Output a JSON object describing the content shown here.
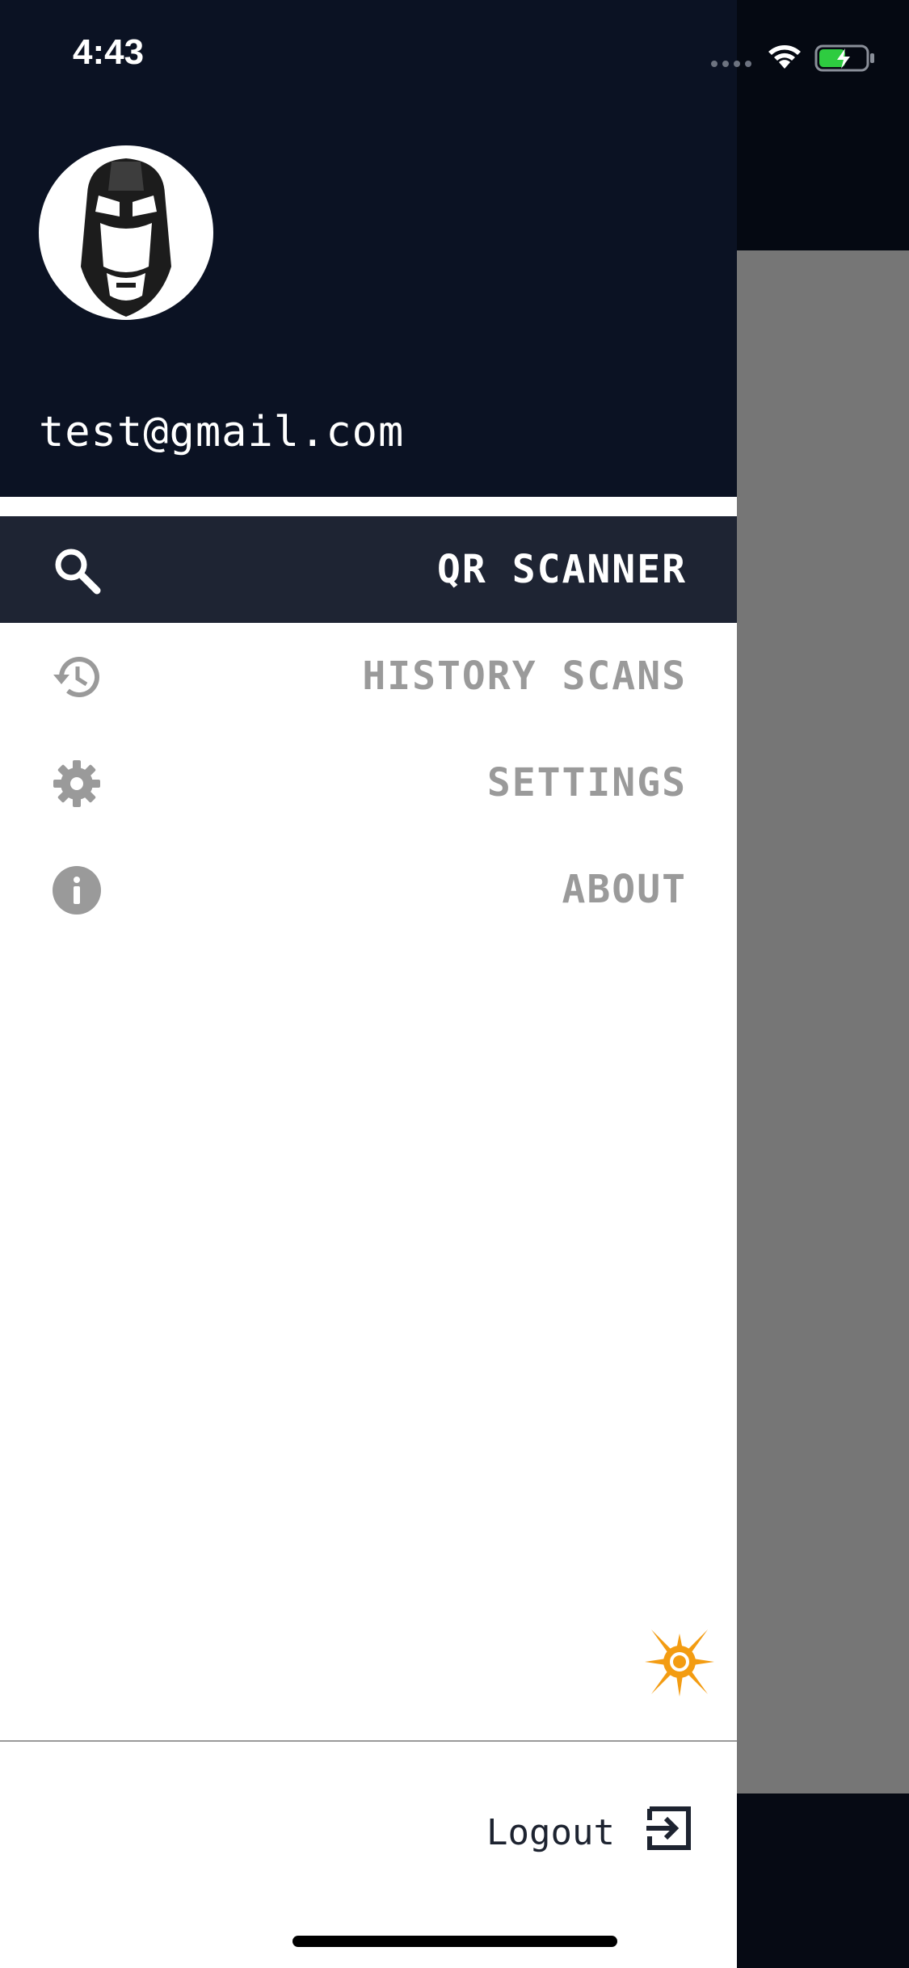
{
  "status_bar": {
    "time": "4:43"
  },
  "profile": {
    "email": "test@gmail.com",
    "avatar_icon": "ironman-mask-icon"
  },
  "menu": {
    "items": [
      {
        "label": "QR SCANNER",
        "icon": "search-icon",
        "active": true
      },
      {
        "label": "HISTORY SCANS",
        "icon": "history-icon",
        "active": false
      },
      {
        "label": "SETTINGS",
        "icon": "gear-icon",
        "active": false
      },
      {
        "label": "ABOUT",
        "icon": "info-icon",
        "active": false
      }
    ]
  },
  "footer": {
    "logout_label": "Logout",
    "logout_icon": "logout-icon"
  },
  "colors": {
    "header_bg": "#0b1223",
    "active_bg": "#1e2433",
    "inactive_text": "#9a9a9a",
    "accent_sun": "#f39c12"
  }
}
